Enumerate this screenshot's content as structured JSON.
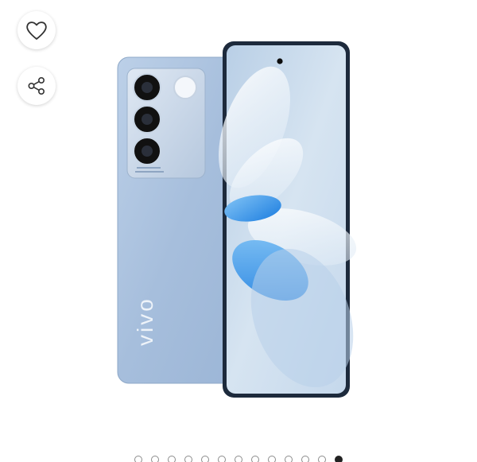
{
  "actions": {
    "wishlist_icon": "heart-outline",
    "share_icon": "share-nodes"
  },
  "product": {
    "brand_mark": "vivo",
    "back_color": "#a9c1de",
    "screen_color": "#cfe0ef",
    "accent_color": "#2f8fe8"
  },
  "carousel": {
    "total_slides": 13,
    "active_index": 12
  }
}
